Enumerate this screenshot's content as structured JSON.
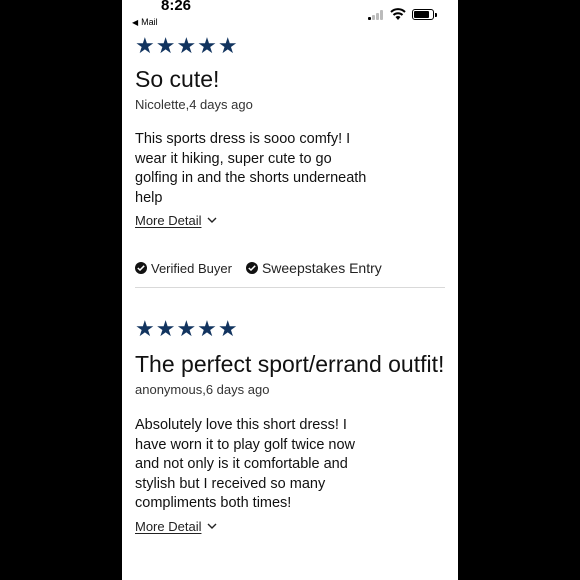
{
  "status_bar": {
    "time": "8:26",
    "back_label": "Mail"
  },
  "reviews": [
    {
      "stars": "★★★★★",
      "rating": 5,
      "title": "So cute!",
      "byline": "Nicolette,4 days ago",
      "body": "This sports dress is sooo comfy! I wear it hiking, super cute to go golfing in and the shorts underneath help",
      "more_label": "More Detail",
      "badges": [
        "Verified Buyer",
        "Sweepstakes Entry"
      ]
    },
    {
      "stars": "★★★★★",
      "rating": 5,
      "title": "The perfect sport/errand outfit!",
      "byline": "anonymous,6 days ago",
      "body": "Absolutely love this short dress! I have worn it to play golf twice now and not only is it comfortable and stylish but I received so many compliments both times!",
      "more_label": "More Detail"
    }
  ],
  "colors": {
    "star": "#12345f",
    "frame": "#000000",
    "divider": "#d9d9d9"
  }
}
